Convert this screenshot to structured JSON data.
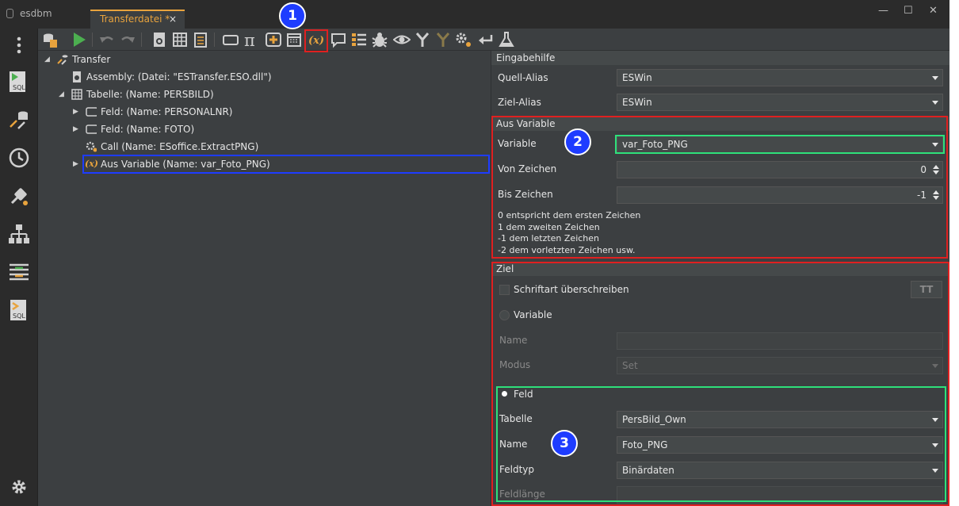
{
  "app": {
    "name": "esdbm"
  },
  "tab": {
    "title": "Transferdatei *",
    "close": "×"
  },
  "window": {
    "minimize": "—",
    "maximize": "☐",
    "close": "✕"
  },
  "tree": {
    "items": [
      {
        "label": "Transfer",
        "icon": "transfer-icon"
      },
      {
        "label": "Assembly: (Datei: \"ESTransfer.ESO.dll\")",
        "icon": "assembly-icon"
      },
      {
        "label": "Tabelle: (Name: PERSBILD)",
        "icon": "table-icon"
      },
      {
        "label": "Feld: (Name: PERSONALNR)",
        "icon": "field-icon"
      },
      {
        "label": "Feld: (Name: FOTO)",
        "icon": "field-icon"
      },
      {
        "label": "Call (Name: ESoffice.ExtractPNG)",
        "icon": "call-gear-icon"
      },
      {
        "label": "Aus Variable (Name: var_Foto_PNG)",
        "icon": "variable-icon",
        "icon_text": "(x)"
      }
    ]
  },
  "toolbar": {
    "variable_glyph": "(x)",
    "pi_glyph": "π"
  },
  "props": {
    "eingabehilfe": {
      "title": "Eingabehilfe",
      "quell_label": "Quell-Alias",
      "quell_value": "ESWin",
      "ziel_label": "Ziel-Alias",
      "ziel_value": "ESWin"
    },
    "aus_variable": {
      "title": "Aus Variable",
      "variable_label": "Variable",
      "variable_value": "var_Foto_PNG",
      "von_label": "Von Zeichen",
      "von_value": "0",
      "bis_label": "Bis Zeichen",
      "bis_value": "-1",
      "hint1": "0 entspricht dem ersten Zeichen",
      "hint2": "1 dem zweiten Zeichen",
      "hint3": "-1 dem letzten Zeichen",
      "hint4": "-2 dem vorletzten Zeichen usw."
    },
    "ziel": {
      "title": "Ziel",
      "schriftart_label": "Schriftart überschreiben",
      "font_button": "TT",
      "variable_radio": "Variable",
      "name_label": "Name",
      "modus_label": "Modus",
      "modus_value": "Set",
      "feld_radio": "Feld",
      "tabelle_label": "Tabelle",
      "tabelle_value": "PersBild_Own",
      "feldname_label": "Name",
      "feldname_value": "Foto_PNG",
      "feldtyp_label": "Feldtyp",
      "feldtyp_value": "Binärdaten",
      "feldlaenge_label": "Feldlänge"
    }
  },
  "annotations": {
    "badge1": "1",
    "badge2": "2",
    "badge3": "3"
  },
  "colors": {
    "accent_tab": "#e8a33d",
    "highlight_red": "#e02020",
    "highlight_green": "#2ee07a",
    "highlight_blue": "#1e3cff",
    "play_green": "#4caf50"
  }
}
